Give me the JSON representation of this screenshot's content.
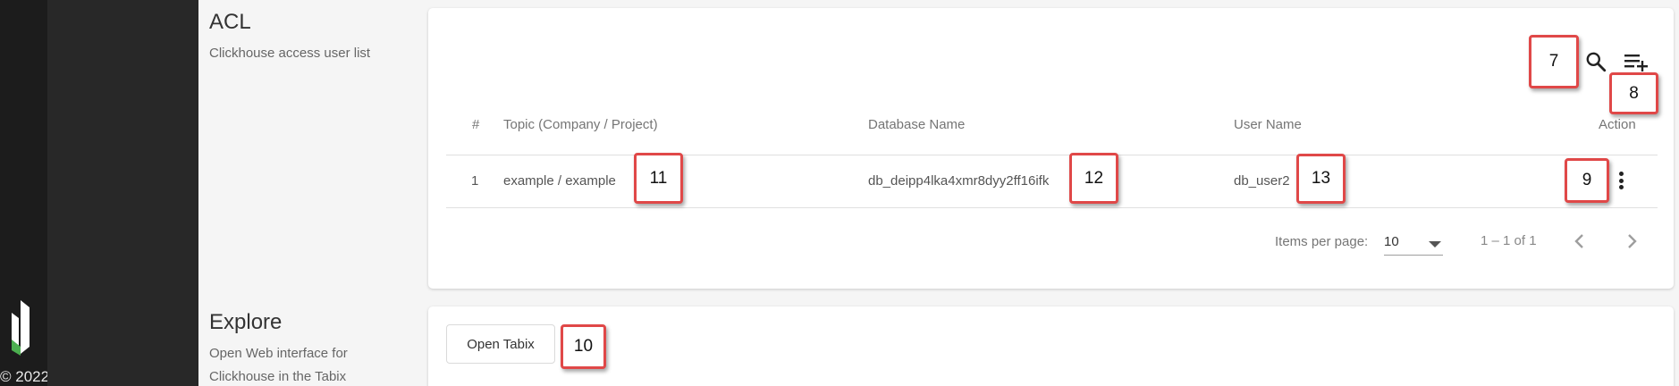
{
  "app": {
    "copyright": "© 2022"
  },
  "acl": {
    "title": "ACL",
    "description": "Clickhouse access user list",
    "icons": {
      "search": "search-icon",
      "add": "playlist-add-icon",
      "actions": "more-vert-icon"
    },
    "table": {
      "headers": {
        "index": "#",
        "topic": "Topic (Company / Project)",
        "database": "Database Name",
        "user": "User Name",
        "action": "Action"
      },
      "rows": [
        {
          "index": "1",
          "topic": "example / example",
          "database": "db_deipp4lka4xmr8dyy2ff16ifk",
          "user": "db_user2"
        }
      ]
    },
    "paginator": {
      "items_per_page_label": "Items per page:",
      "items_per_page_value": "10",
      "range_label": "1 – 1 of 1"
    }
  },
  "explore": {
    "title": "Explore",
    "description_line1": "Open Web interface for",
    "description_line2": "Clickhouse in the Tabix",
    "open_tabix_label": "Open Tabix"
  },
  "callouts": {
    "c7": "7",
    "c8": "8",
    "c9": "9",
    "c10": "10",
    "c11": "11",
    "c12": "12",
    "c13": "13"
  },
  "colors": {
    "rail": "#1c1c1c",
    "sidebar": "#282828",
    "callout_border": "#e04848",
    "logo_white": "#ffffff",
    "logo_green": "#4caf50"
  }
}
